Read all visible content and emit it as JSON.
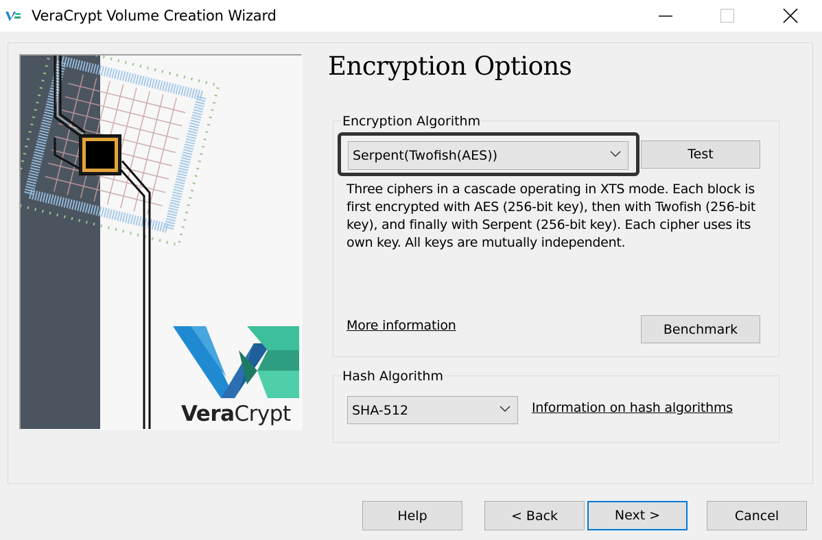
{
  "window": {
    "title": "VeraCrypt Volume Creation Wizard",
    "icon": "veracrypt-logo-icon",
    "controls": [
      "minimize-icon",
      "maximize-icon",
      "close-icon"
    ]
  },
  "side_image": {
    "brand_text_bold": "Vera",
    "brand_text_light": "Crypt"
  },
  "page_title": "Encryption Options",
  "encryption": {
    "group_label": "Encryption Algorithm",
    "selected": "Serpent(Twofish(AES))",
    "test_label": "Test",
    "description": "Three ciphers in a cascade operating in XTS mode. Each block is first encrypted with AES (256-bit key), then with Twofish (256-bit key), and finally with Serpent (256-bit key). Each cipher uses its own key. All keys are mutually independent.",
    "more_info_label": "More information",
    "benchmark_label": "Benchmark"
  },
  "hash": {
    "group_label": "Hash Algorithm",
    "selected": "SHA-512",
    "info_label": "Information on hash algorithms"
  },
  "footer": {
    "help_label": "Help",
    "back_label": "< Back",
    "next_label": "Next >",
    "cancel_label": "Cancel"
  },
  "colors": {
    "accent": "#0078d7",
    "panel_bg": "#f0f0f0",
    "sidebar_dark": "#4b5560",
    "logo_blue": "#1f8ad2",
    "logo_green": "#3dbf9c"
  }
}
